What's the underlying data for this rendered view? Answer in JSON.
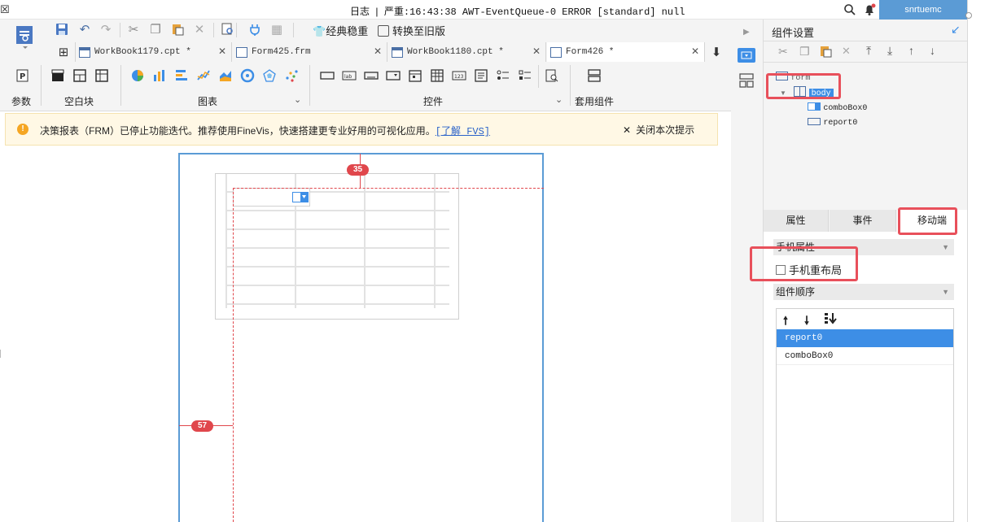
{
  "titlebar": {
    "menu_icon": "close-window-icon",
    "log_label": "日志",
    "status": "严重:16:43:38 AWT-EventQueue-0 ERROR [standard] null",
    "user": "snrtuemc"
  },
  "toolbar": {
    "classic_label": "经典稳重",
    "convert_label": "转换至旧版",
    "tabs": [
      {
        "label": "WorkBook1179.cpt *"
      },
      {
        "label": "Form425.frm"
      },
      {
        "label": "WorkBook1180.cpt *"
      },
      {
        "label": "Form426 *"
      }
    ],
    "groups": {
      "params": "参数",
      "blank": "空白块",
      "chart": "图表",
      "widget": "控件",
      "template": "套用组件"
    }
  },
  "notice": {
    "text": "决策报表（FRM）已停止功能迭代。推荐使用FineVis，快速搭建更专业好用的可视化应用。",
    "link": "[了解 FVS]",
    "close_label": "关闭本次提示"
  },
  "canvas": {
    "top_marker": "35",
    "left_marker": "57"
  },
  "right_panel": {
    "title": "组件设置",
    "tree": [
      {
        "label": "form"
      },
      {
        "label": "body"
      },
      {
        "label": "comboBox0"
      },
      {
        "label": "report0"
      }
    ],
    "tabs": [
      "属性",
      "事件",
      "移动端"
    ],
    "mobile_section": "手机属性",
    "relayout_label": "手机重布局",
    "relayout_checked": false,
    "order_section": "组件顺序",
    "order_items": [
      {
        "label": "report0",
        "selected": true
      },
      {
        "label": "comboBox0",
        "selected": false
      }
    ]
  },
  "colors": {
    "accent": "#5b9bd5",
    "selection": "#3d8ee6",
    "highlight_red": "#e8505b",
    "guide_red": "#e0474c",
    "notice_bg": "#fff8e5"
  }
}
